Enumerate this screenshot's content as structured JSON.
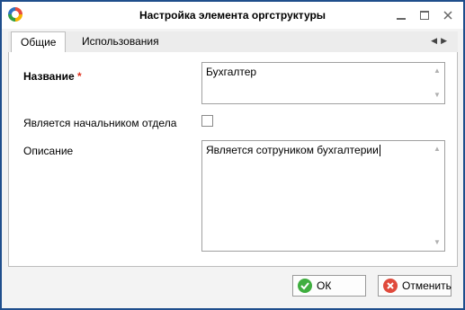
{
  "window": {
    "title": "Настройка элемента оргструктуры"
  },
  "tabs": [
    {
      "label": "Общие",
      "active": true
    },
    {
      "label": "Использования",
      "active": false
    }
  ],
  "form": {
    "name_label": "Название",
    "required_mark": "*",
    "name_value": "Бухгалтер",
    "is_head_label": "Является начальником отдела",
    "is_head_checked": false,
    "description_label": "Описание",
    "description_value": "Является сотруником бухгалтерии"
  },
  "footer": {
    "ok_label": "ОК",
    "cancel_label": "Отменить"
  },
  "icons": {
    "minimize": "minimize-icon",
    "maximize": "maximize-icon",
    "close": "close-icon",
    "ok": "check-icon",
    "cancel": "x-circle-icon"
  },
  "colors": {
    "border": "#1f4e8c",
    "ok_icon": "#3fae3f",
    "cancel_icon": "#e04a3c",
    "required": "#e0301e"
  }
}
